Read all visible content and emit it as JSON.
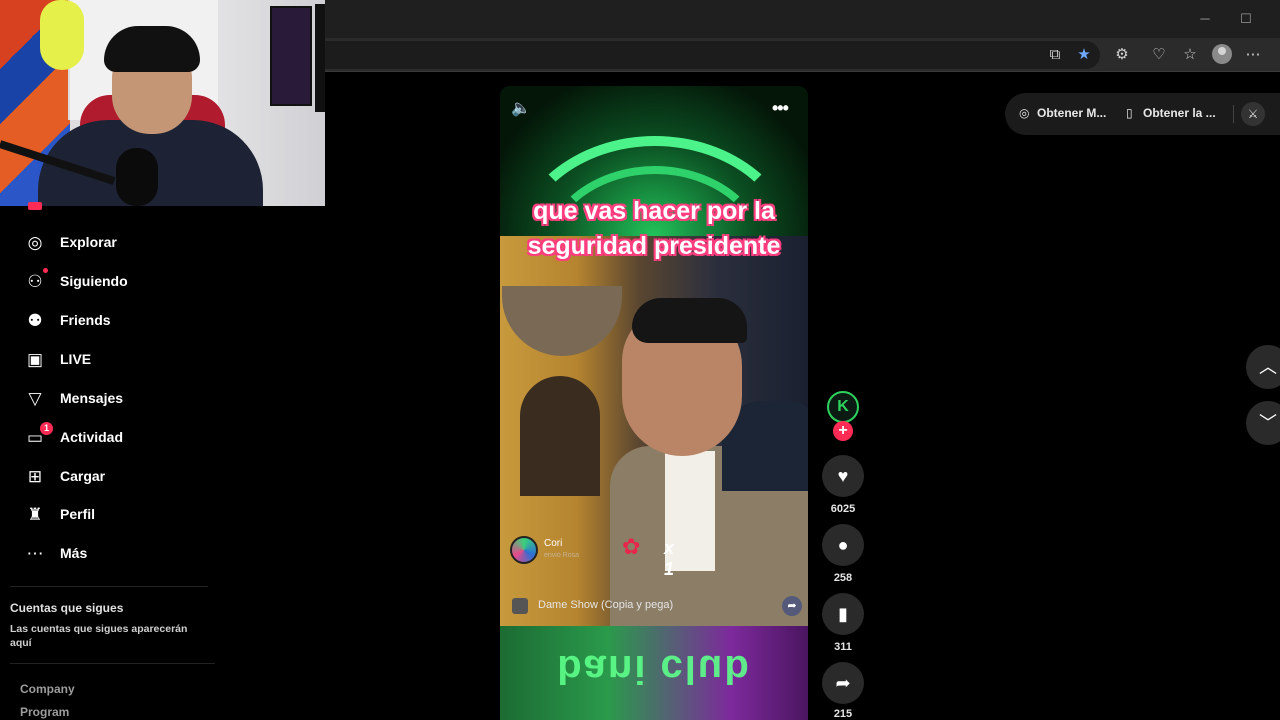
{
  "video": {
    "caption_line1": "que vas hacer por la",
    "caption_line2": "seguridad presidente",
    "gift_user": "Cori",
    "gift_sub": "envió Rosa",
    "gift_count": "x 1",
    "music": "Dame Show (Copia y pega)",
    "neon_sign": "bani club"
  },
  "actions": {
    "creator_initial": "K",
    "likes": "6025",
    "comments": "258",
    "saves": "311",
    "shares": "215"
  },
  "sidebar": {
    "items": [
      {
        "label": "Explorar",
        "icon": "compass-icon"
      },
      {
        "label": "Siguiendo",
        "icon": "following-icon"
      },
      {
        "label": "Friends",
        "icon": "friends-icon"
      },
      {
        "label": "LIVE",
        "icon": "live-icon"
      },
      {
        "label": "Mensajes",
        "icon": "messages-icon"
      },
      {
        "label": "Actividad",
        "icon": "activity-icon",
        "badge": "1"
      },
      {
        "label": "Cargar",
        "icon": "upload-icon"
      },
      {
        "label": "Perfil",
        "icon": "profile-icon"
      },
      {
        "label": "Más",
        "icon": "more-icon"
      }
    ],
    "following_title": "Cuentas que sigues",
    "following_desc": "Las cuentas que sigues aparecerán aquí",
    "footer_links": [
      "Company",
      "Program"
    ]
  },
  "topbar": {
    "get_app_1": "Obtener M...",
    "get_app_2": "Obtener la ..."
  },
  "colors": {
    "accent": "#fe2c55",
    "background": "#000000"
  }
}
